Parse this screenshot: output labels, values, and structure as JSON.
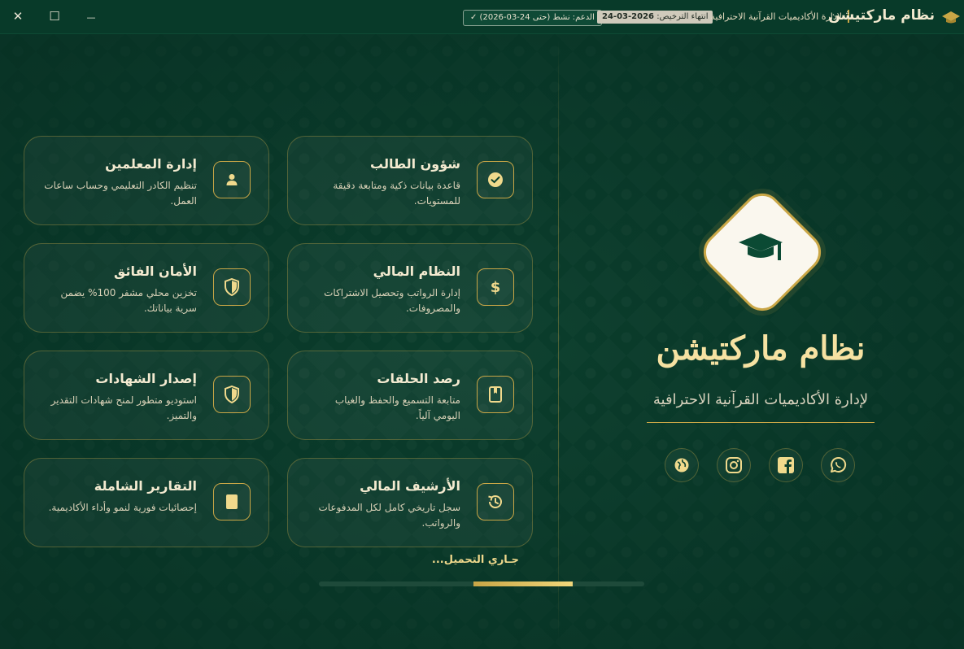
{
  "titlebar": {
    "app_name": "نظام ماركتيشن",
    "app_subtitle": "لإدارة الأكاديميات القرآنية الاحترافية",
    "license_label": "انتهاء الترخيص:",
    "license_date": "2026-03-24",
    "support_text": "الدعم: نشط (حتى 24-03-2026) ✓",
    "close_icon": "✕",
    "maximize_icon": "☐",
    "minimize_icon": "—"
  },
  "features": [
    {
      "title": "شؤون الطالب",
      "desc": "قاعدة بيانات ذكية ومتابعة دقيقة للمستويات.",
      "icon": "check-circle-icon"
    },
    {
      "title": "إدارة المعلمين",
      "desc": "تنظيم الكادر التعليمي وحساب ساعات العمل.",
      "icon": "user-icon"
    },
    {
      "title": "النظام المالي",
      "desc": "إدارة الرواتب وتحصيل الاشتراكات والمصروفات.",
      "icon": "dollar-icon"
    },
    {
      "title": "الأمان الفائق",
      "desc": "تخزين محلي مشفر 100% يضمن سرية بياناتك.",
      "icon": "shield-icon"
    },
    {
      "title": "رصد الحلقات",
      "desc": "متابعة التسميع والحفظ والغياب اليومي آلياً.",
      "icon": "book-icon"
    },
    {
      "title": "إصدار الشهادات",
      "desc": "استوديو متطور لمنح شهادات التقدير والتميز.",
      "icon": "shield-icon"
    },
    {
      "title": "الأرشيف المالي",
      "desc": "سجل تاريخي كامل لكل المدفوعات والرواتب.",
      "icon": "history-icon"
    },
    {
      "title": "التقارير الشاملة",
      "desc": "إحصائيات فورية لنمو وأداء الأكاديمية.",
      "icon": "document-icon"
    }
  ],
  "hero": {
    "title": "نظام ماركتيشن",
    "subtitle": "لإدارة الأكاديميات القرآنية الاحترافية"
  },
  "social": [
    "globe-icon",
    "instagram-icon",
    "facebook-icon",
    "whatsapp-icon"
  ],
  "loading": {
    "text": "جـاري التحميل...",
    "progress_start": 0.475,
    "progress_end": 0.78
  },
  "colors": {
    "accent_gold": "#c9a646",
    "background_green": "#0b3f2d",
    "title_gold": "#f6e2a2"
  }
}
